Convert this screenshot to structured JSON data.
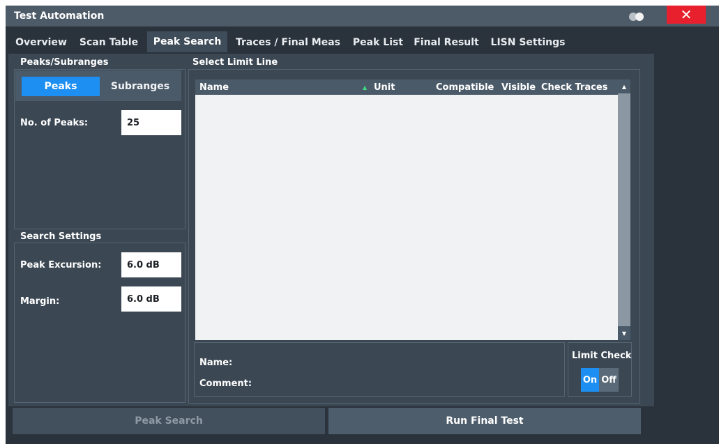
{
  "window": {
    "title": "Test Automation",
    "close_label": "✕"
  },
  "tabs": [
    {
      "label": "Overview"
    },
    {
      "label": "Scan Table"
    },
    {
      "label": "Peak Search",
      "active": true
    },
    {
      "label": "Traces / Final Meas"
    },
    {
      "label": "Peak List"
    },
    {
      "label": "Final Result"
    },
    {
      "label": "LISN Settings"
    }
  ],
  "peaks_subranges": {
    "title": "Peaks/Subranges",
    "peaks_label": "Peaks",
    "subranges_label": "Subranges",
    "selected": "Peaks",
    "no_of_peaks_label": "No. of Peaks:",
    "no_of_peaks_value": "25"
  },
  "search_settings": {
    "title": "Search Settings",
    "peak_excursion_label": "Peak Excursion:",
    "peak_excursion_value": "6.0 dB",
    "margin_label": "Margin:",
    "margin_value": "6.0 dB"
  },
  "limit_line": {
    "title": "Select Limit Line",
    "columns": [
      "Name",
      "Unit",
      "Compatible",
      "Visible",
      "Check Traces"
    ],
    "sort_indicator": "▲",
    "rows": [],
    "name_label": "Name:",
    "comment_label": "Comment:",
    "limit_check_label": "Limit Check",
    "limit_check_on": "On",
    "limit_check_off": "Off",
    "limit_check_state": "On"
  },
  "buttons": {
    "peak_search": "Peak Search",
    "run_final_test": "Run Final Test"
  },
  "colors": {
    "accent": "#1d8ff2",
    "close": "#e8202d",
    "background": "#2a323b",
    "panel": "#3b4753"
  }
}
